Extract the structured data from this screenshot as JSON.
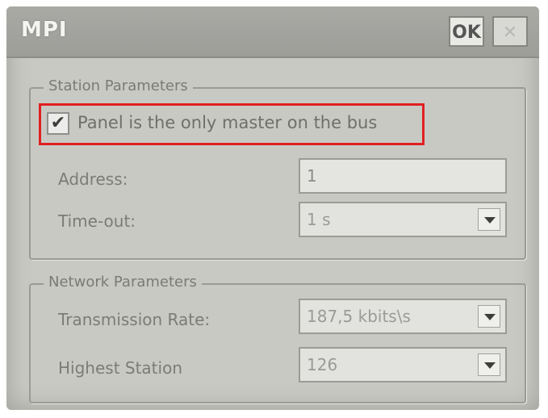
{
  "window": {
    "title": "MPI",
    "ok_label": "OK",
    "close_label": "✕"
  },
  "station": {
    "group_label": "Station Parameters",
    "only_master_label": "Panel is the only master on the bus",
    "only_master_checked": true,
    "address_label": "Address:",
    "address_value": "1",
    "timeout_label": "Time-out:",
    "timeout_value": "1 s"
  },
  "network": {
    "group_label": "Network Parameters",
    "rate_label": "Transmission Rate:",
    "rate_value": "187,5 kbits\\s",
    "highest_label": "Highest Station",
    "highest_value": "126"
  },
  "annotation": {
    "highlight_color": "#e02020"
  },
  "icons": {
    "check": "checkmark-icon",
    "dropdown": "chevron-down-icon",
    "close": "close-icon"
  }
}
